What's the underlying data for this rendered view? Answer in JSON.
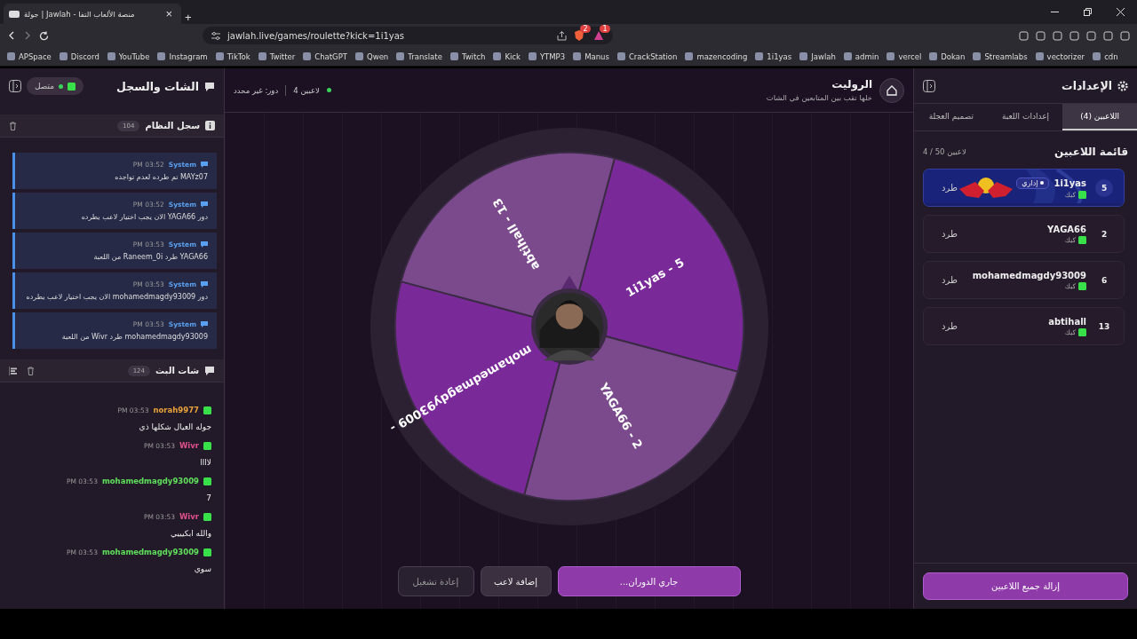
{
  "browser": {
    "tab": {
      "title": "جولة | Jawlah - منصة الألعاب التفا",
      "close": "×"
    },
    "new_tab": "+",
    "url": "jawlah.live/games/roulette?kick=1i1yas",
    "extension_badges": [
      "1",
      "2"
    ],
    "bookmarks": [
      "cdn",
      "vectorizer",
      "Streamlabs",
      "Dokan",
      "vercel",
      "admin",
      "Jawlah",
      "1i1yas",
      "mazencoding",
      "CrackStation",
      "Manus",
      "YTMP3",
      "Kick",
      "Twitch",
      "Translate",
      "Qwen",
      "ChatGPT",
      "Twitter",
      "TikTok",
      "Instagram",
      "YouTube",
      "Discord",
      "APSpace"
    ]
  },
  "settings": {
    "title": "الإعدادات",
    "tabs": [
      {
        "label": "اللاعبين (4)",
        "selected": true
      },
      {
        "label": "إعدادات اللعبة",
        "selected": false
      },
      {
        "label": "تصميم العجلة",
        "selected": false
      }
    ],
    "list_title": "قائمة اللاعبين",
    "list_count": "4 / 50 لاعبين",
    "players": [
      {
        "number": "5",
        "name": "1i1yas",
        "badge": "إداري",
        "platform": "كيك",
        "kick": "طرد",
        "highlighted": true
      },
      {
        "number": "2",
        "name": "YAGA66",
        "platform": "كيك",
        "kick": "طرد",
        "highlighted": false
      },
      {
        "number": "6",
        "name": "mohamedmagdy93009",
        "platform": "كيك",
        "kick": "طرد",
        "highlighted": false
      },
      {
        "number": "13",
        "name": "abtihall",
        "platform": "كيك",
        "kick": "طرد",
        "highlighted": false
      }
    ],
    "remove_all": "إزالة جميع اللاعبين"
  },
  "game": {
    "title": "الروليت",
    "subtitle": "خلها تقب بين المتابعين في الشات",
    "players_count": "4 لاعبين",
    "turn": "دور: غير محدد",
    "wheel": [
      {
        "label": "1i1yas - 5",
        "color": "#7a2a98"
      },
      {
        "label": "YAGA66 - 2",
        "color": "#7b4a8c"
      },
      {
        "label": "mohamedmagdy93009 -",
        "color": "#7a2a98"
      },
      {
        "label": "abtihall - 13",
        "color": "#7b4a8c"
      }
    ],
    "buttons": [
      {
        "label": "جاري الدوران...",
        "kind": "primary"
      },
      {
        "label": "إضافة لاعب",
        "kind": "secondary"
      },
      {
        "label": "إعادة تشغيل",
        "kind": "disabled"
      }
    ]
  },
  "chat_panel": {
    "title": "الشات والسجل",
    "status": "متصل",
    "system_log": {
      "title": "سجل النظام",
      "count": "104",
      "entries": [
        {
          "author": "System",
          "time": "PM 03:52",
          "text": "MAYz07 تم طرده لعدم تواجده"
        },
        {
          "author": "System",
          "time": "PM 03:52",
          "text": "دور YAGA66 الان يجب اختيار لاعب يطرده"
        },
        {
          "author": "System",
          "time": "PM 03:53",
          "text": "YAGA66 طرد Raneem_0i من اللعبة"
        },
        {
          "author": "System",
          "time": "PM 03:53",
          "text": "دور mohamedmagdy93009 الان يجب اختيار لاعب يطرده"
        },
        {
          "author": "System",
          "time": "PM 03:53",
          "text": "mohamedmagdy93009 طرد Wivr من اللعبة"
        }
      ]
    },
    "stream_chat": {
      "title": "شات البث",
      "count": "124",
      "messages": [
        {
          "user": "norah9977",
          "color": "#e8a23a",
          "time": "PM 03:53",
          "text": "جوله العيال شكلها ذي"
        },
        {
          "user": "Wivr",
          "color": "#e0508a",
          "time": "PM 03:53",
          "text": "لاااا"
        },
        {
          "user": "mohamedmagdy93009",
          "color": "#5ee05a",
          "time": "PM 03:53",
          "text": "7"
        },
        {
          "user": "Wivr",
          "color": "#e0508a",
          "time": "PM 03:53",
          "text": "والله ابكيييي"
        },
        {
          "user": "mohamedmagdy93009",
          "color": "#5ee05a",
          "time": "PM 03:53",
          "text": "سوي"
        }
      ]
    }
  }
}
